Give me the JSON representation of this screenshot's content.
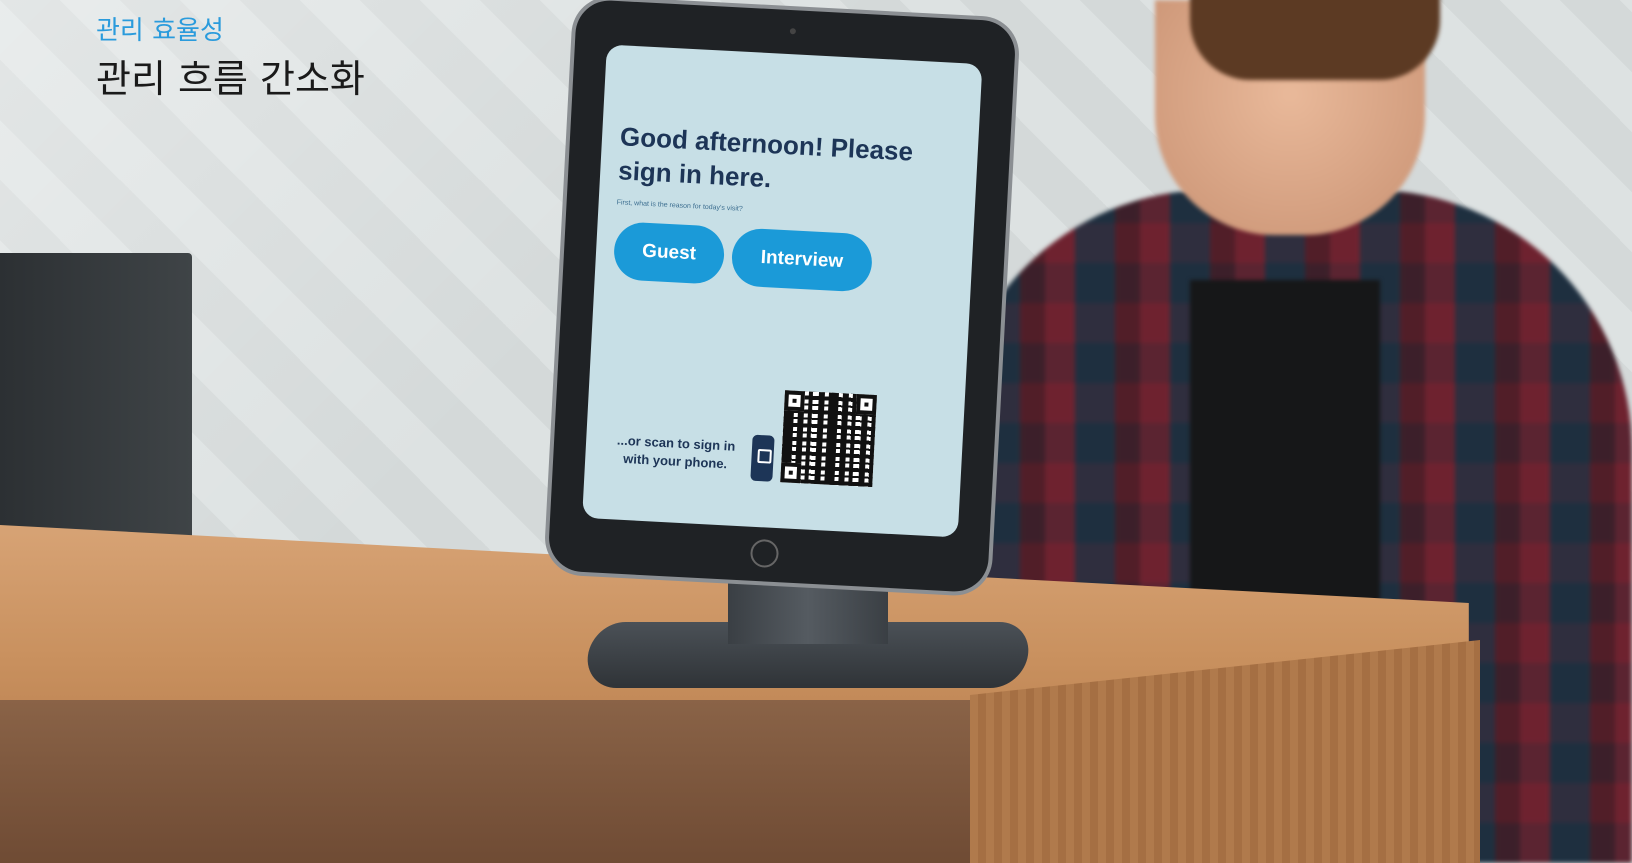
{
  "caption": {
    "eyebrow": "관리 효율성",
    "headline": "관리 흐름 간소화"
  },
  "kiosk": {
    "greeting": "Good afternoon! Please sign in here.",
    "subprompt": "First, what is the reason for today's visit?",
    "buttons": [
      "Guest",
      "Interview"
    ],
    "scan_text": "...or scan to sign in with your phone.",
    "accent_color": "#1b9ad8",
    "icons": [
      "phone-icon",
      "lock-icon",
      "qr-code"
    ]
  }
}
